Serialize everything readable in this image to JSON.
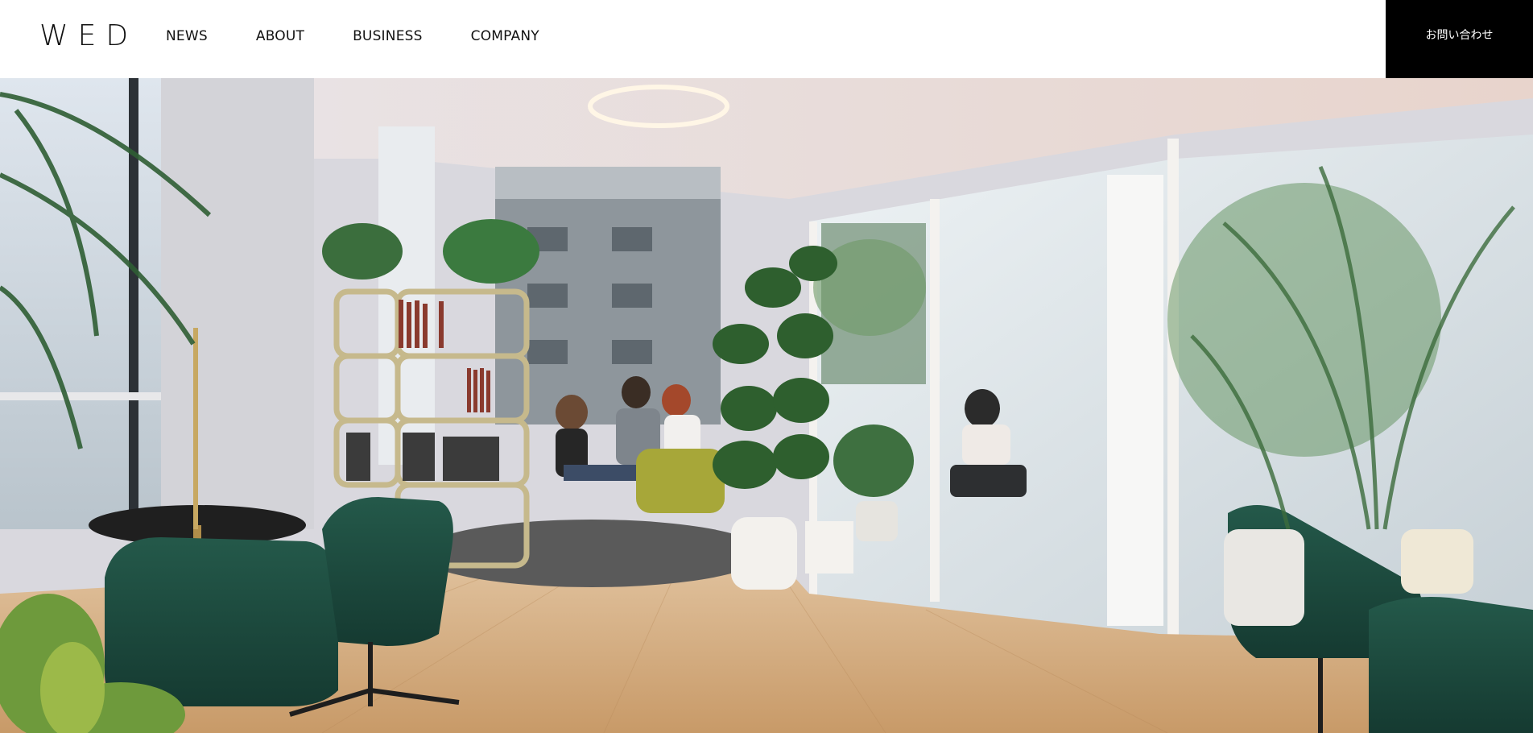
{
  "header": {
    "logo": "WED",
    "nav": [
      {
        "label": "NEWS"
      },
      {
        "label": "ABOUT"
      },
      {
        "label": "BUSINESS"
      },
      {
        "label": "COMPANY"
      }
    ],
    "contact_label": "お問い合わせ"
  },
  "colors": {
    "header_bg": "#ffffff",
    "contact_bg": "#000000",
    "contact_text": "#ffffff",
    "nav_text": "#111111"
  }
}
